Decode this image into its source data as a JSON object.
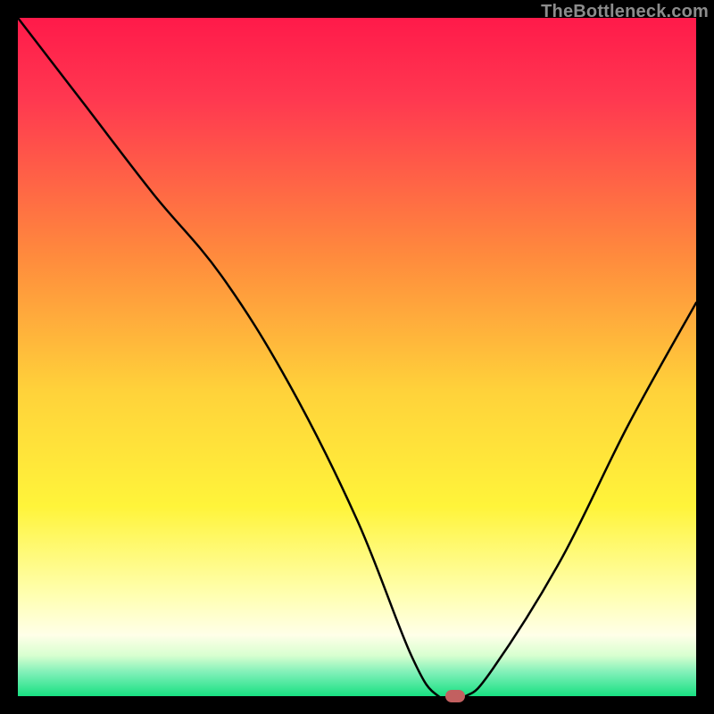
{
  "watermark": "TheBottleneck.com",
  "chart_data": {
    "type": "line",
    "title": "",
    "xlabel": "",
    "ylabel": "",
    "xlim": [
      0,
      100
    ],
    "ylim": [
      0,
      100
    ],
    "grid": false,
    "legend": false,
    "series": [
      {
        "name": "bottleneck-curve",
        "x": [
          0,
          10,
          20,
          30,
          40,
          50,
          58,
          62,
          66,
          70,
          80,
          90,
          100
        ],
        "y": [
          100,
          87,
          74,
          62,
          46,
          26,
          6,
          0,
          0,
          4,
          20,
          40,
          58
        ]
      }
    ],
    "marker": {
      "x": 64.5,
      "y": 0,
      "color": "#c26060"
    },
    "background": {
      "type": "vertical-gradient",
      "stops": [
        {
          "pct": 0.0,
          "color": "#ff1a4a"
        },
        {
          "pct": 0.12,
          "color": "#ff3850"
        },
        {
          "pct": 0.35,
          "color": "#ff8a3d"
        },
        {
          "pct": 0.55,
          "color": "#ffd23a"
        },
        {
          "pct": 0.72,
          "color": "#fff43a"
        },
        {
          "pct": 0.85,
          "color": "#ffffb0"
        },
        {
          "pct": 0.91,
          "color": "#ffffe8"
        },
        {
          "pct": 0.94,
          "color": "#d8ffd0"
        },
        {
          "pct": 0.965,
          "color": "#80f0b8"
        },
        {
          "pct": 1.0,
          "color": "#18e082"
        }
      ]
    },
    "line_color": "#000000",
    "line_width": 2.5
  }
}
